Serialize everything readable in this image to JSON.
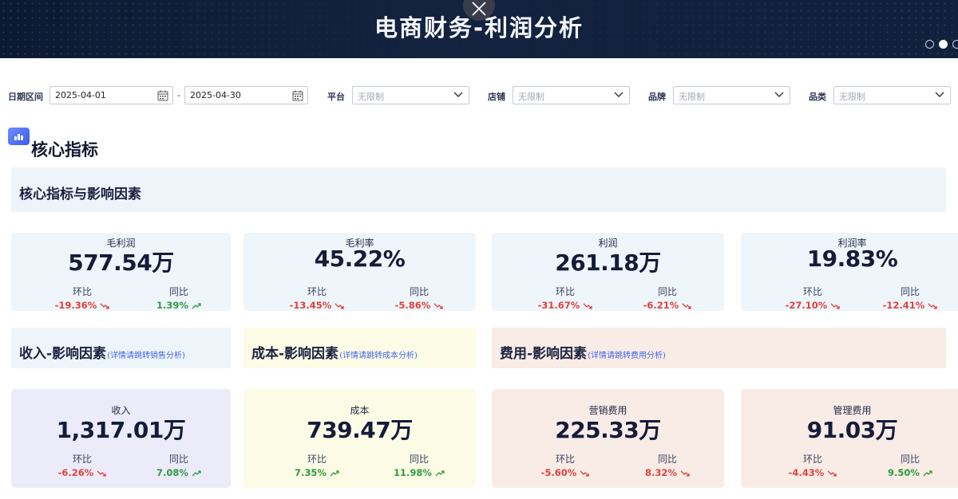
{
  "banner": {
    "title": "电商财务-利润分析",
    "pager_count": 3,
    "pager_active": 1
  },
  "filters": {
    "date_label": "日期区间",
    "date_start": "2025-04-01",
    "date_sep": "-",
    "date_end": "2025-04-30",
    "platform_label": "平台",
    "platform_value": "无限制",
    "store_label": "店铺",
    "store_value": "无限制",
    "brand_label": "品牌",
    "brand_value": "无限制",
    "category_label": "品类",
    "category_value": "无限制"
  },
  "section": {
    "title": "核心指标"
  },
  "core_panel": {
    "title": "核心指标与影响因素"
  },
  "core_cards": [
    {
      "name": "毛利润",
      "value": "577.54万",
      "mom_label": "环比",
      "mom": "-19.36%",
      "mom_dir": "down",
      "yoy_label": "同比",
      "yoy": "1.39%",
      "yoy_dir": "up"
    },
    {
      "name": "毛利率",
      "value": "45.22%",
      "mom_label": "环比",
      "mom": "-13.45%",
      "mom_dir": "down",
      "yoy_label": "同比",
      "yoy": "-5.86%",
      "yoy_dir": "down"
    },
    {
      "name": "利润",
      "value": "261.18万",
      "mom_label": "环比",
      "mom": "-31.67%",
      "mom_dir": "down",
      "yoy_label": "同比",
      "yoy": "-6.21%",
      "yoy_dir": "down"
    },
    {
      "name": "利润率",
      "value": "19.83%",
      "mom_label": "环比",
      "mom": "-27.10%",
      "mom_dir": "down",
      "yoy_label": "同比",
      "yoy": "-12.41%",
      "yoy_dir": "down"
    }
  ],
  "factor_panels": {
    "income": {
      "title": "收入-影响因素",
      "link": "(详情请跳转销售分析)"
    },
    "cost": {
      "title": "成本-影响因素",
      "link": "(详情请跳转成本分析)"
    },
    "expense": {
      "title": "费用-影响因素",
      "link": "(详情请跳转费用分析)"
    }
  },
  "factor_cards": [
    {
      "name": "收入",
      "value": "1,317.01万",
      "mom_label": "环比",
      "mom": "-6.26%",
      "mom_dir": "down",
      "yoy_label": "同比",
      "yoy": "7.08%",
      "yoy_dir": "up"
    },
    {
      "name": "成本",
      "value": "739.47万",
      "mom_label": "环比",
      "mom": "7.35%",
      "mom_dir": "up",
      "yoy_label": "同比",
      "yoy": "11.98%",
      "yoy_dir": "up"
    },
    {
      "name": "营销费用",
      "value": "225.33万",
      "mom_label": "环比",
      "mom": "-5.60%",
      "mom_dir": "down",
      "yoy_label": "同比",
      "yoy": "8.32%",
      "yoy_dir": "down"
    },
    {
      "name": "管理费用",
      "value": "91.03万",
      "mom_label": "环比",
      "mom": "-4.43%",
      "mom_dir": "down",
      "yoy_label": "同比",
      "yoy": "9.50%",
      "yoy_dir": "up"
    }
  ],
  "colors": {
    "banner_bg": "#10203d",
    "core_card_bg": "#eef5fb",
    "income_bg": "#ecebfa",
    "cost_bg": "#fcfbe6",
    "expense_bg": "#f9ebe6",
    "negative": "#e0423b",
    "positive": "#2f9a3e",
    "link": "#4467e6"
  },
  "icons": {
    "close": "close-icon",
    "calendar": "calendar-icon",
    "dropdown": "chevron-down-icon",
    "section": "bar-chart-icon",
    "down": "trend-down-arrow-icon",
    "up": "trend-up-arrow-icon"
  }
}
